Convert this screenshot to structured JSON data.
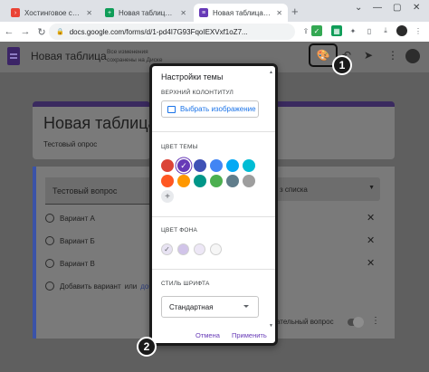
{
  "browser": {
    "tabs": [
      {
        "label": "Хостинговое сообще",
        "color": "#ea4335",
        "glyph": "›"
      },
      {
        "label": "Новая таблица - Goo",
        "color": "#0f9d58",
        "glyph": "+"
      },
      {
        "label": "Новая таблица - Goo",
        "color": "#673ab7",
        "glyph": "≡"
      }
    ],
    "url": "docs.google.com/forms/d/1-pd4I7G93FqoIEXVxf1oZ7..."
  },
  "forms_header": {
    "title": "Новая таблица",
    "saved_status": "Все изменения сохранены на Диске"
  },
  "form": {
    "title": "Новая таблица",
    "description": "Тестовый опрос",
    "question": "Тестовый вопрос",
    "options": [
      "Вариант А",
      "Вариант Б",
      "Вариант В"
    ],
    "add_option": "Добавить вариант",
    "or_text": "или",
    "add_other": "доб",
    "type_label": "з списка",
    "required_label": "ательный вопрос"
  },
  "theme_panel": {
    "title": "Настройки темы",
    "header_section": "ВЕРХНИЙ КОЛОНТИТУЛ",
    "choose_image": "Выбрать изображение",
    "theme_color_section": "ЦВЕТ ТЕМЫ",
    "theme_colors": [
      "#db4437",
      "#673ab7",
      "#3f51b5",
      "#4285f4",
      "#03a9f4",
      "#00bcd4",
      "#ff5722",
      "#ff9800",
      "#009688",
      "#4caf50",
      "#607d8b",
      "#9e9e9e"
    ],
    "selected_theme_color": "#673ab7",
    "bg_color_section": "ЦВЕТ ФОНА",
    "bg_colors": [
      "#e8e3f3",
      "#d1c4e9",
      "#ede7f6",
      "#f6f6f6"
    ],
    "font_section": "СТИЛЬ ШРИФТА",
    "font_value": "Стандартная",
    "cancel": "Отмена",
    "apply": "Применить"
  },
  "badges": {
    "one": "1",
    "two": "2"
  }
}
